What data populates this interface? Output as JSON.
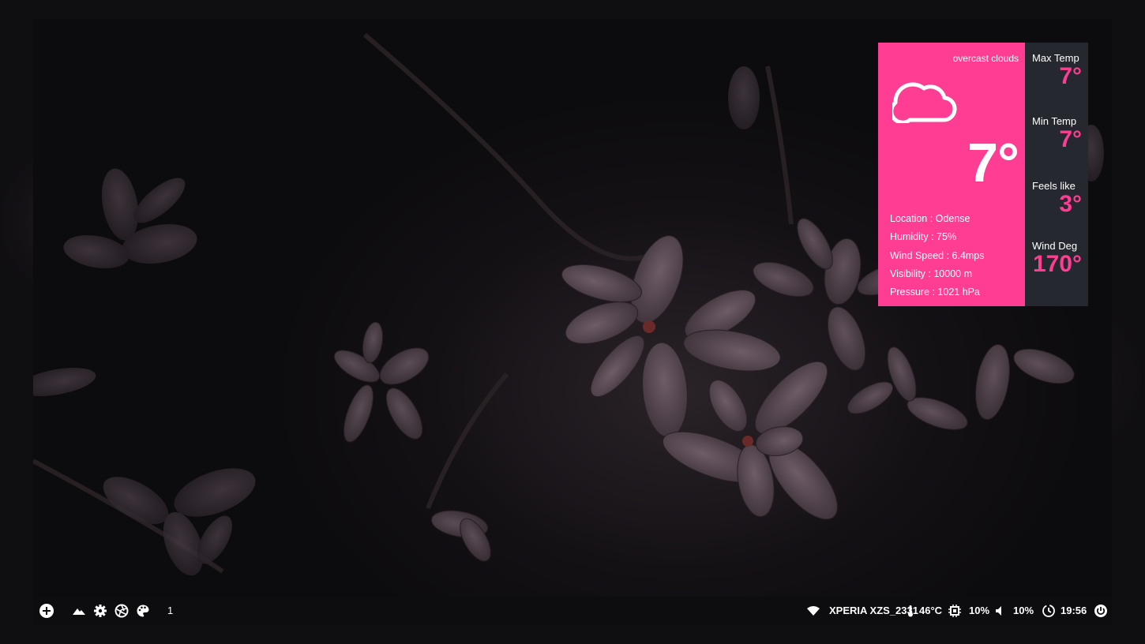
{
  "weather": {
    "condition": "overcast clouds",
    "icon": "cloud-icon",
    "temperature": "7°",
    "details": [
      "Location : Odense",
      "Humidity : 75%",
      "Wind Speed : 6.4mps",
      "Visibility : 10000 m",
      "Pressure : 1021 hPa"
    ],
    "side": [
      {
        "label": "Max Temp",
        "value": "7°"
      },
      {
        "label": "Min Temp",
        "value": "7°"
      },
      {
        "label": "Feels like",
        "value": "3°"
      },
      {
        "label": "Wind Deg",
        "value": "170°"
      }
    ],
    "colors": {
      "accent": "#ff3d92",
      "panel": "#26282f"
    }
  },
  "taskbar": {
    "left_icons": [
      "plus-icon",
      "mountain-icon",
      "gear-icon",
      "aperture-icon",
      "palette-icon"
    ],
    "workspace": "1",
    "network": "XPERIA XZS_2331",
    "temperature": "46°C",
    "cpu": "10%",
    "volume": "10%",
    "clock": "19:56",
    "right_icons": [
      "wifi-icon",
      "thermometer-icon",
      "cpu-icon",
      "speaker-icon",
      "clock-icon",
      "power-icon"
    ]
  }
}
